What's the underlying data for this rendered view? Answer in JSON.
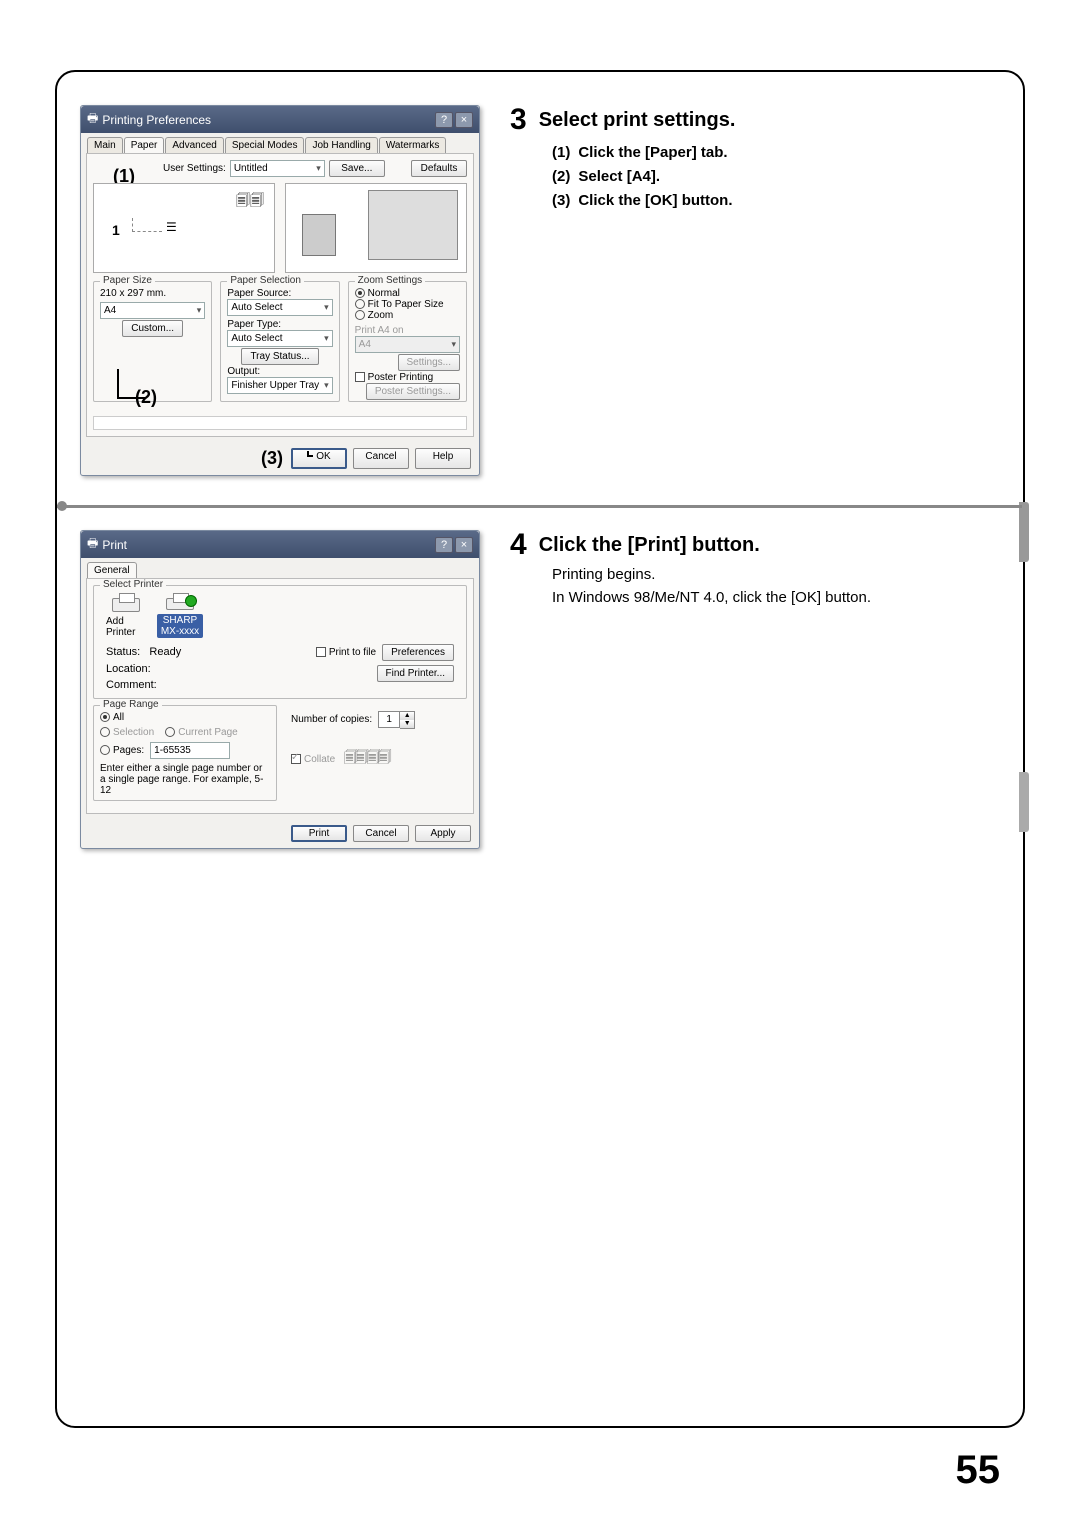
{
  "page_number": "55",
  "step3": {
    "num": "3",
    "title": "Select print settings.",
    "items": [
      {
        "n": "(1)",
        "t": "Click the [Paper] tab."
      },
      {
        "n": "(2)",
        "t": "Select [A4]."
      },
      {
        "n": "(3)",
        "t": "Click the [OK] button."
      }
    ]
  },
  "step4": {
    "num": "4",
    "title": "Click the [Print] button.",
    "desc1": "Printing begins.",
    "desc2": "In Windows 98/Me/NT 4.0, click the [OK] button."
  },
  "callouts": {
    "c1": "(1)",
    "c2": "(2)",
    "c3": "(3)",
    "one": "1"
  },
  "prefs": {
    "title": "Printing Preferences",
    "tabs": [
      "Main",
      "Paper",
      "Advanced",
      "Special Modes",
      "Job Handling",
      "Watermarks"
    ],
    "userSettingsLabel": "User Settings:",
    "userSettingsValue": "Untitled",
    "saveBtn": "Save...",
    "defaultsBtn": "Defaults",
    "paperSize": {
      "legend": "Paper Size",
      "dim": "210 x 297 mm.",
      "value": "A4",
      "customBtn": "Custom..."
    },
    "paperSel": {
      "legend": "Paper Selection",
      "srcLabel": "Paper Source:",
      "srcValue": "Auto Select",
      "typeLabel": "Paper Type:",
      "typeValue": "Auto Select",
      "trayBtn": "Tray Status...",
      "outputLabel": "Output:",
      "outputValue": "Finisher Upper Tray"
    },
    "zoom": {
      "legend": "Zoom Settings",
      "normal": "Normal",
      "fit": "Fit To Paper Size",
      "zoom": "Zoom",
      "printOn": "Print A4 on",
      "printOnVal": "A4",
      "settingsBtn": "Settings...",
      "poster": "Poster Printing",
      "posterBtn": "Poster Settings..."
    },
    "ok": "OK",
    "cancel": "Cancel",
    "help": "Help"
  },
  "print": {
    "title": "Print",
    "tabGeneral": "General",
    "selectPrinter": "Select Printer",
    "addPrinter": "Add Printer",
    "sharpName": "SHARP\nMX-xxxx",
    "statusLabel": "Status:",
    "statusValue": "Ready",
    "locationLabel": "Location:",
    "commentLabel": "Comment:",
    "printToFile": "Print to file",
    "preferencesBtn": "Preferences",
    "findPrinterBtn": "Find Printer...",
    "pageRange": {
      "legend": "Page Range",
      "all": "All",
      "selection": "Selection",
      "current": "Current Page",
      "pages": "Pages:",
      "pagesVal": "1-65535",
      "hint": "Enter either a single page number or a single page range.  For example, 5-12"
    },
    "copiesLabel": "Number of copies:",
    "copiesVal": "1",
    "collate": "Collate",
    "printBtn": "Print",
    "cancelBtn": "Cancel",
    "applyBtn": "Apply"
  }
}
